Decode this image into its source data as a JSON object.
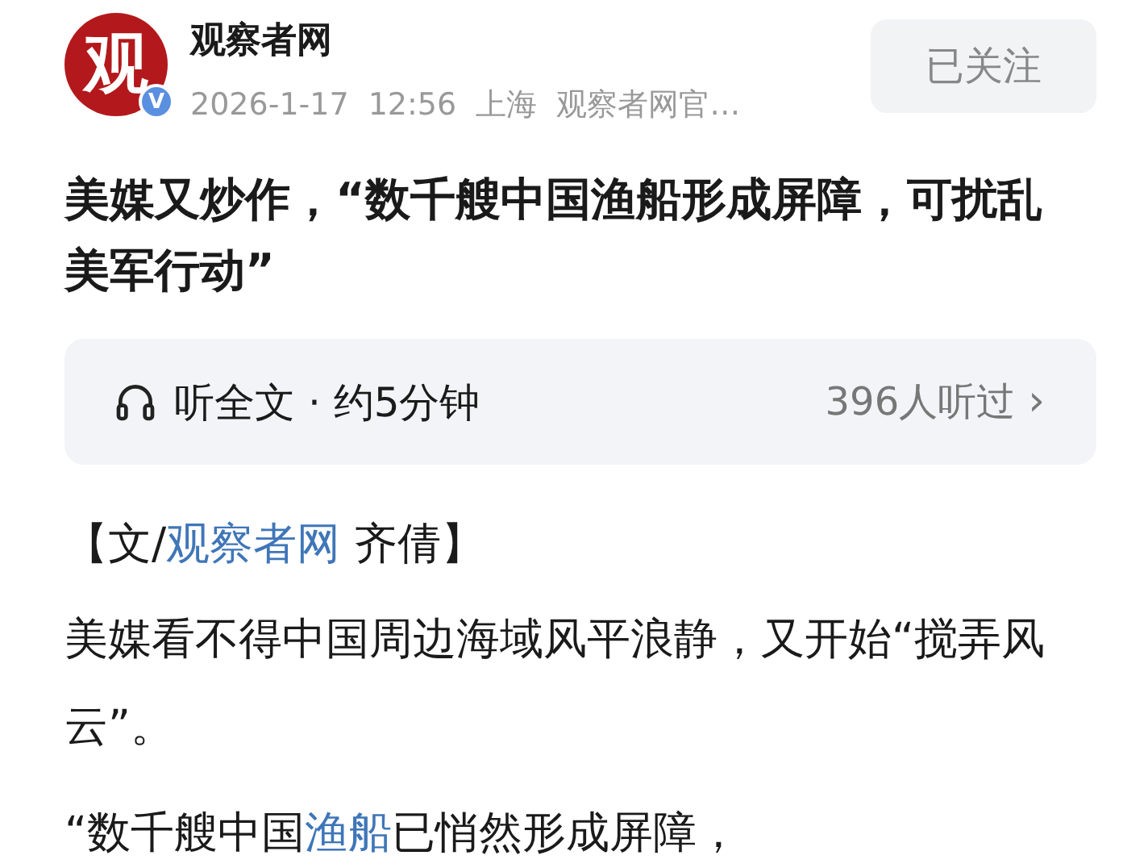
{
  "author": {
    "avatar_text": "观",
    "verified_mark": "V",
    "name": "观察者网",
    "date": "2026-1-17",
    "time": "12:56",
    "location": "上海",
    "source": "观察者网官…"
  },
  "follow_button": {
    "label": "已关注",
    "followed": true
  },
  "title": "美媒又炒作，“数千艘中国渔船形成屏障，可扰乱美军行动”",
  "audio": {
    "label": "听全文 · 约5分钟",
    "listeners": "396人听过",
    "chevron": "›"
  },
  "byline": [
    {
      "text": "【文/",
      "kind": "text"
    },
    {
      "text": "观察者网",
      "kind": "link"
    },
    {
      "text": " 齐倩】",
      "kind": "text"
    }
  ],
  "paragraphs": [
    [
      {
        "text": "美媒看不得中国周边海域风平浪静，又开始“搅弄风云”。",
        "kind": "text"
      }
    ],
    [
      {
        "text": "“数千艘中国",
        "kind": "text"
      },
      {
        "text": "渔船",
        "kind": "link"
      },
      {
        "text": "已悄然形成屏障，",
        "kind": "text"
      }
    ]
  ]
}
